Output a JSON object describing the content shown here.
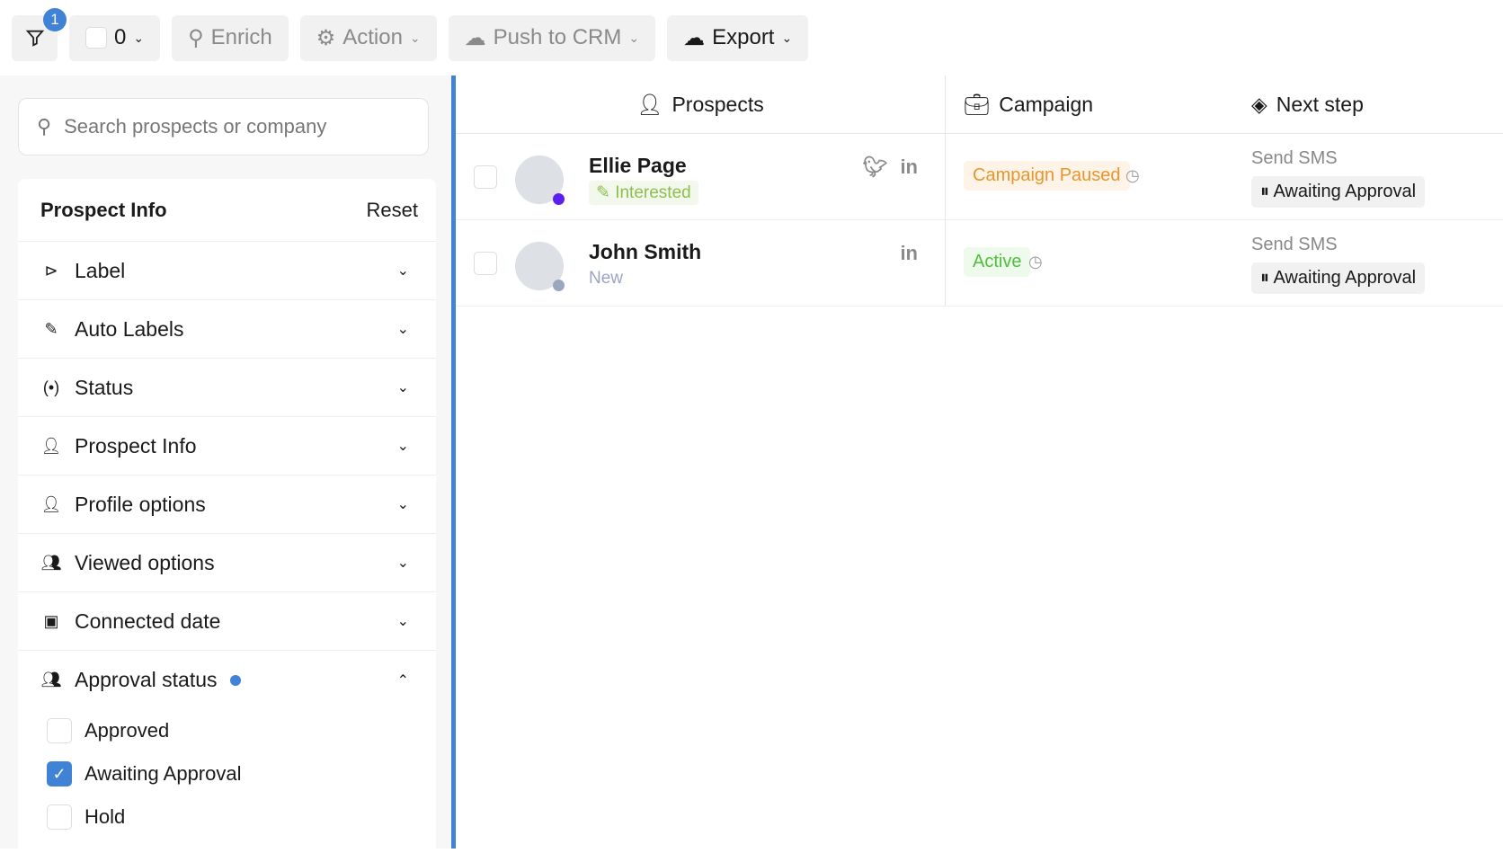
{
  "toolbar": {
    "filter_count": "1",
    "selected_count": "0",
    "enrich": "Enrich",
    "action": "Action",
    "push": "Push to CRM",
    "export": "Export"
  },
  "sidebar": {
    "search_placeholder": "Search prospects or company",
    "panel_title": "Prospect Info",
    "reset": "Reset",
    "filters": [
      "Label",
      "Auto Labels",
      "Status",
      "Prospect Info",
      "Profile options",
      "Viewed options",
      "Connected date",
      "Approval status"
    ],
    "approval_options": [
      {
        "label": "Approved",
        "checked": false
      },
      {
        "label": "Awaiting Approval",
        "checked": true
      },
      {
        "label": "Hold",
        "checked": false
      }
    ]
  },
  "table": {
    "headers": [
      "Prospects",
      "Campaign",
      "Next step"
    ],
    "rows": [
      {
        "name": "Ellie Page",
        "label": "Interested",
        "campaign": "Campaign Paused",
        "next_step": "Send SMS",
        "approval": "Awaiting Approval"
      },
      {
        "name": "John Smith",
        "label": "New",
        "campaign": "Active",
        "next_step": "Send SMS",
        "approval": "Awaiting Approval"
      }
    ]
  },
  "colors": {
    "accent": "#3f82d6",
    "paused": "#e8952e",
    "active": "#4fbf3a",
    "interested": "#8cbf4f"
  }
}
